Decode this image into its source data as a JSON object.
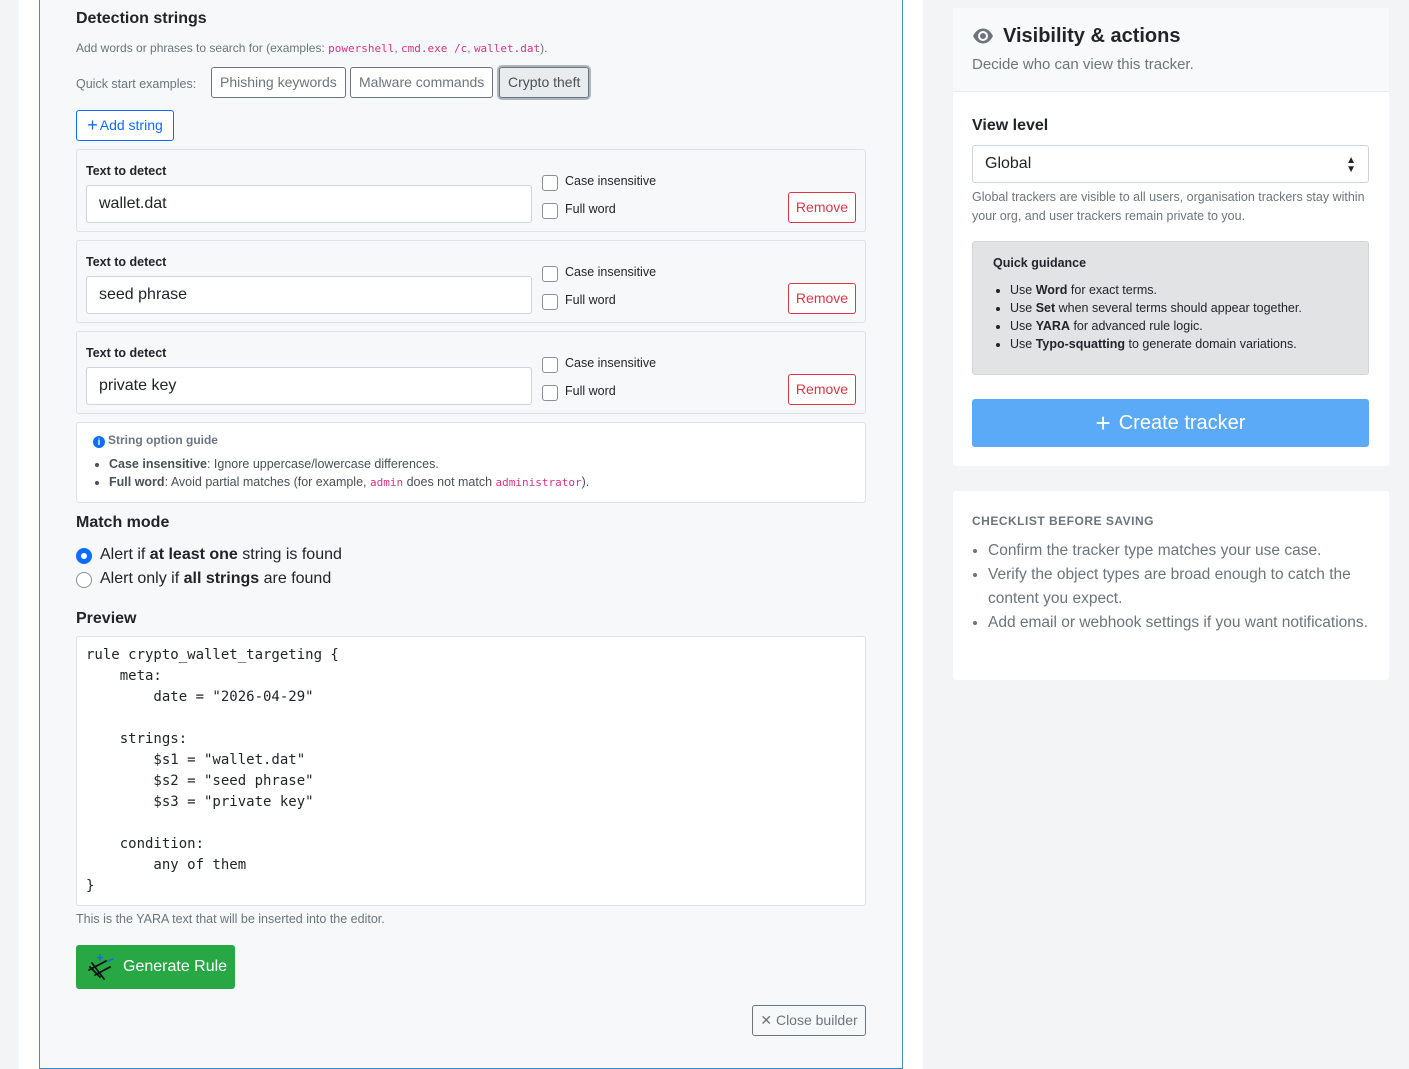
{
  "detection": {
    "title": "Detection strings",
    "hint_prefix": "Add words or phrases to search for (examples: ",
    "hint_examples": [
      "powershell",
      "cmd.exe /c",
      "wallet.dat"
    ],
    "hint_suffix": ").",
    "quick_start_label": "Quick start examples:",
    "quick_start": [
      "Phishing keywords",
      "Malware commands",
      "Crypto theft"
    ],
    "active_quick_start": "Crypto theft",
    "add_string_label": "Add string",
    "text_to_detect_label": "Text to detect",
    "case_insensitive_label": "Case insensitive",
    "full_word_label": "Full word",
    "remove_label": "Remove",
    "strings": [
      {
        "value": "wallet.dat",
        "case_insensitive": false,
        "full_word": false
      },
      {
        "value": "seed phrase",
        "case_insensitive": false,
        "full_word": false
      },
      {
        "value": "private key",
        "case_insensitive": false,
        "full_word": false
      }
    ]
  },
  "guide": {
    "title": "String option guide",
    "ci_term": "Case insensitive",
    "ci_text": ": Ignore uppercase/lowercase differences.",
    "fw_term": "Full word",
    "fw_text_a": ": Avoid partial matches (for example, ",
    "fw_code_a": "admin",
    "fw_text_b": " does not match ",
    "fw_code_b": "administrator",
    "fw_text_c": ")."
  },
  "match_mode": {
    "title": "Match mode",
    "opt1_a": "Alert if ",
    "opt1_b": "at least one",
    "opt1_c": " string is found",
    "opt2_a": "Alert only if ",
    "opt2_b": "all strings",
    "opt2_c": " are found",
    "selected": "at least one"
  },
  "preview": {
    "title": "Preview",
    "code": "rule crypto_wallet_targeting {\n    meta:\n        date = \"2026-04-29\"\n\n    strings:\n        $s1 = \"wallet.dat\"\n        $s2 = \"seed phrase\"\n        $s3 = \"private key\"\n\n    condition:\n        any of them\n}",
    "help": "This is the YARA text that will be inserted into the editor."
  },
  "buttons": {
    "generate": "Generate Rule",
    "close": "Close builder"
  },
  "visibility": {
    "title": "Visibility & actions",
    "subtitle": "Decide who can view this tracker.",
    "view_level_label": "View level",
    "view_level_value": "Global",
    "help": "Global trackers are visible to all users, organisation trackers stay within your org, and user trackers remain private to you.",
    "guidance_title": "Quick guidance",
    "guidance": [
      {
        "pre": "Use ",
        "term": "Word",
        "post": " for exact terms."
      },
      {
        "pre": "Use ",
        "term": "Set",
        "post": " when several terms should appear together."
      },
      {
        "pre": "Use ",
        "term": "YARA",
        "post": " for advanced rule logic."
      },
      {
        "pre": "Use ",
        "term": "Typo-squatting",
        "post": " to generate domain variations."
      }
    ],
    "create_label": "Create tracker"
  },
  "checklist": {
    "title": "CHECKLIST BEFORE SAVING",
    "items": [
      "Confirm the tracker type matches your use case.",
      "Verify the object types are broad enough to catch the content you expect.",
      "Add email or webhook settings if you want notifications."
    ]
  },
  "colors": {
    "primary": "#0d6efd",
    "danger": "#dc3545",
    "success": "#28a745",
    "create_button": "#5baaf7",
    "code_pink": "#d63384"
  }
}
